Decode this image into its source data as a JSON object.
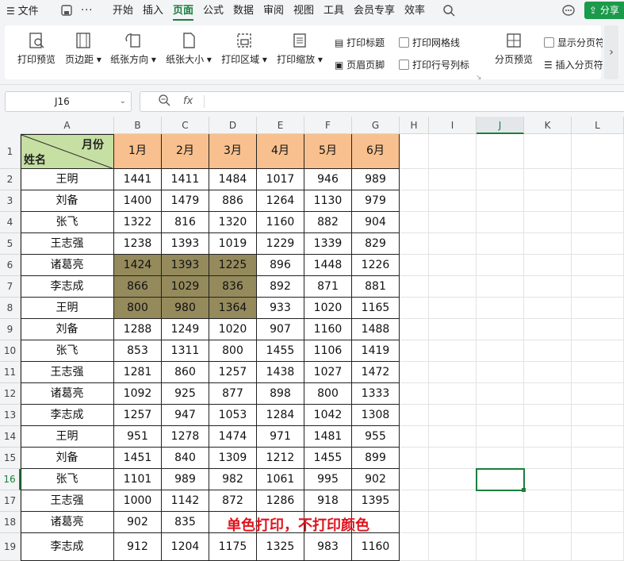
{
  "menu": {
    "file": "文件",
    "tabs": [
      "开始",
      "插入",
      "页面",
      "公式",
      "数据",
      "审阅",
      "视图",
      "工具",
      "会员专享",
      "效率"
    ],
    "active_tab": "页面",
    "share": "分享"
  },
  "ribbon": {
    "print_preview": "打印预览",
    "margins": "页边距",
    "orientation": "纸张方向",
    "size": "纸张大小",
    "print_area": "打印区域",
    "scale": "打印缩放",
    "print_titles": "打印标题",
    "header_footer": "页眉页脚",
    "print_gridlines": "打印网格线",
    "print_row_col_headers": "打印行号列标",
    "page_break_preview": "分页预览",
    "show_page_breaks": "显示分页符",
    "insert_page_break": "插入分页符"
  },
  "formula_bar": {
    "name_box": "J16",
    "fx": "fx",
    "content": ""
  },
  "columns": [
    "A",
    "B",
    "C",
    "D",
    "E",
    "F",
    "G",
    "H",
    "I",
    "J",
    "K",
    "L"
  ],
  "selected_column": "J",
  "selected_row": 16,
  "row_numbers": [
    "1",
    "2",
    "3",
    "4",
    "5",
    "6",
    "7",
    "8",
    "9",
    "10",
    "11",
    "12",
    "13",
    "14",
    "15",
    "16",
    "17",
    "18",
    "19"
  ],
  "table": {
    "diag_top": "月份",
    "diag_bottom": "姓名",
    "months": [
      "1月",
      "2月",
      "3月",
      "4月",
      "5月",
      "6月"
    ],
    "rows": [
      {
        "name": "王明",
        "values": [
          "1441",
          "1411",
          "1484",
          "1017",
          "946",
          "989"
        ]
      },
      {
        "name": "刘备",
        "values": [
          "1400",
          "1479",
          "886",
          "1264",
          "1130",
          "979"
        ]
      },
      {
        "name": "张飞",
        "values": [
          "1322",
          "816",
          "1320",
          "1160",
          "882",
          "904"
        ]
      },
      {
        "name": "王志强",
        "values": [
          "1238",
          "1393",
          "1019",
          "1229",
          "1339",
          "829"
        ]
      },
      {
        "name": "诸葛亮",
        "values": [
          "1424",
          "1393",
          "1225",
          "896",
          "1448",
          "1226"
        ]
      },
      {
        "name": "李志成",
        "values": [
          "866",
          "1029",
          "836",
          "892",
          "871",
          "881"
        ]
      },
      {
        "name": "王明",
        "values": [
          "800",
          "980",
          "1364",
          "933",
          "1020",
          "1165"
        ]
      },
      {
        "name": "刘备",
        "values": [
          "1288",
          "1249",
          "1020",
          "907",
          "1160",
          "1488"
        ]
      },
      {
        "name": "张飞",
        "values": [
          "853",
          "1311",
          "800",
          "1455",
          "1106",
          "1419"
        ]
      },
      {
        "name": "王志强",
        "values": [
          "1281",
          "860",
          "1257",
          "1438",
          "1027",
          "1472"
        ]
      },
      {
        "name": "诸葛亮",
        "values": [
          "1092",
          "925",
          "877",
          "898",
          "800",
          "1333"
        ]
      },
      {
        "name": "李志成",
        "values": [
          "1257",
          "947",
          "1053",
          "1284",
          "1042",
          "1308"
        ]
      },
      {
        "name": "王明",
        "values": [
          "951",
          "1278",
          "1474",
          "971",
          "1481",
          "955"
        ]
      },
      {
        "name": "刘备",
        "values": [
          "1451",
          "840",
          "1309",
          "1212",
          "1455",
          "899"
        ]
      },
      {
        "name": "张飞",
        "values": [
          "1101",
          "989",
          "982",
          "1061",
          "995",
          "902"
        ]
      },
      {
        "name": "王志强",
        "values": [
          "1000",
          "1142",
          "872",
          "1286",
          "918",
          "1395"
        ]
      },
      {
        "name": "诸葛亮",
        "values": [
          "902",
          "835",
          "",
          "",
          "",
          ""
        ]
      },
      {
        "name": "李志成",
        "values": [
          "912",
          "1204",
          "1175",
          "1325",
          "983",
          "1160"
        ]
      }
    ]
  },
  "colors": {
    "header_fill": "#f8c08e",
    "diag_fill": "#c6dfa3",
    "highlight_fill": "#958a5c",
    "accent": "#1a7f3c",
    "annotation": "#e0121b"
  },
  "annotation": "单色打印，不打印颜色"
}
